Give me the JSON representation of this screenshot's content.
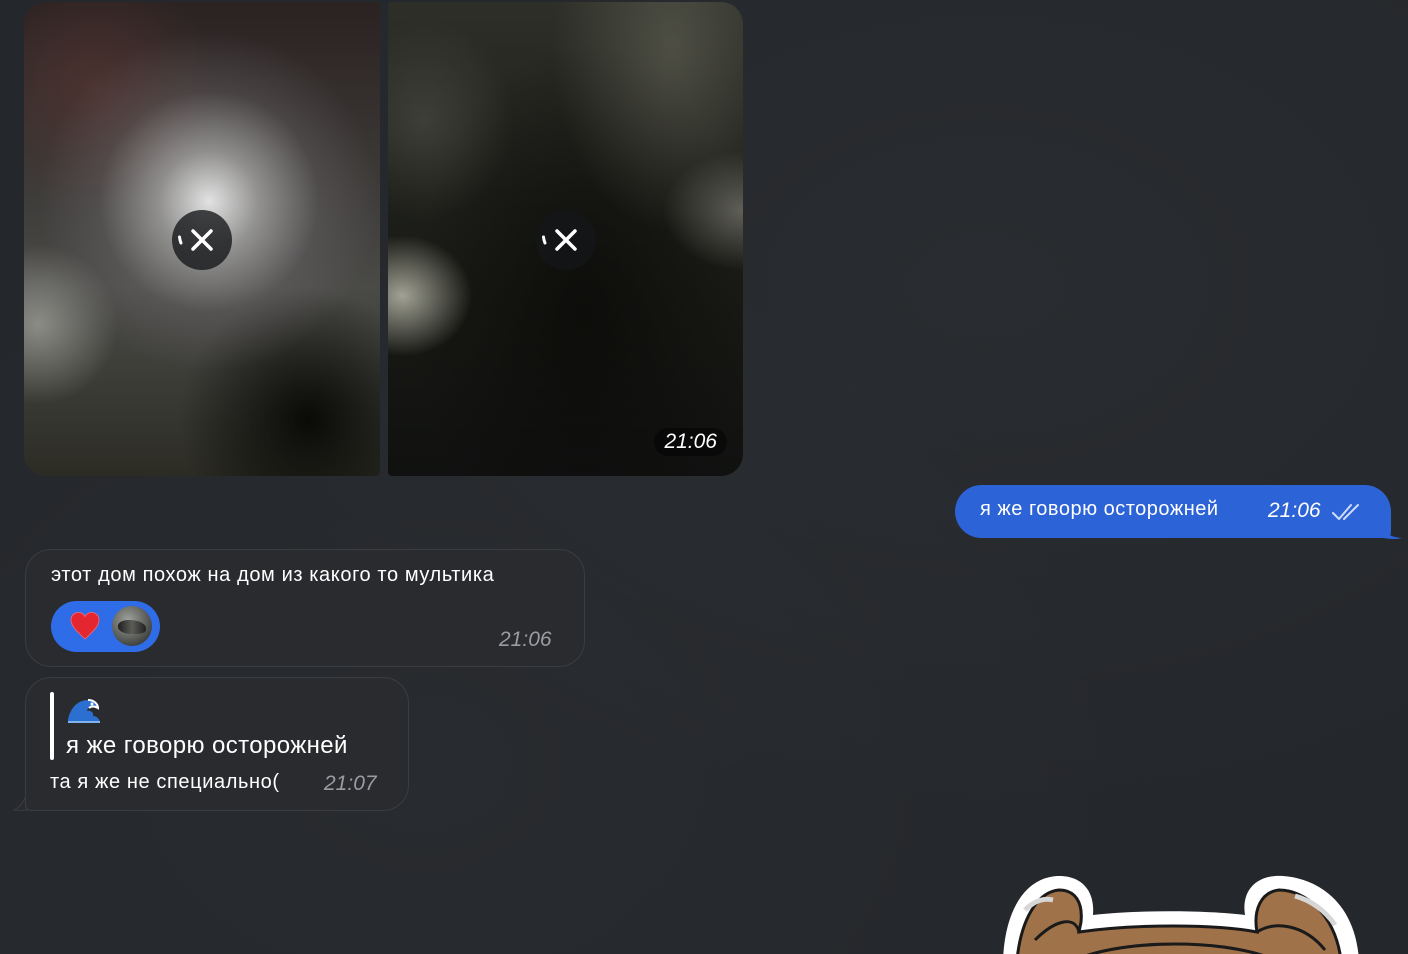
{
  "album": {
    "photos": [
      {
        "state": "uploading",
        "cancel_icon": "close-icon"
      },
      {
        "state": "uploading",
        "cancel_icon": "close-icon"
      }
    ],
    "time": "21:06"
  },
  "outgoing_message": {
    "text": "я же говорю осторожней",
    "time": "21:06",
    "status_icon": "double-check-icon",
    "color": "#2c63d6"
  },
  "incoming_message_1": {
    "text": "этот дом похож на дом из какого то мультика",
    "time": "21:06",
    "reaction": {
      "emoji": "heart-icon",
      "color": "#2f6ce8"
    }
  },
  "incoming_message_2": {
    "reply_emoji": "wave-icon",
    "reply_text": "я же говорю осторожней",
    "text": "та я же не специально(",
    "time": "21:07"
  },
  "sticker": {
    "icon": "sticker-dog"
  }
}
